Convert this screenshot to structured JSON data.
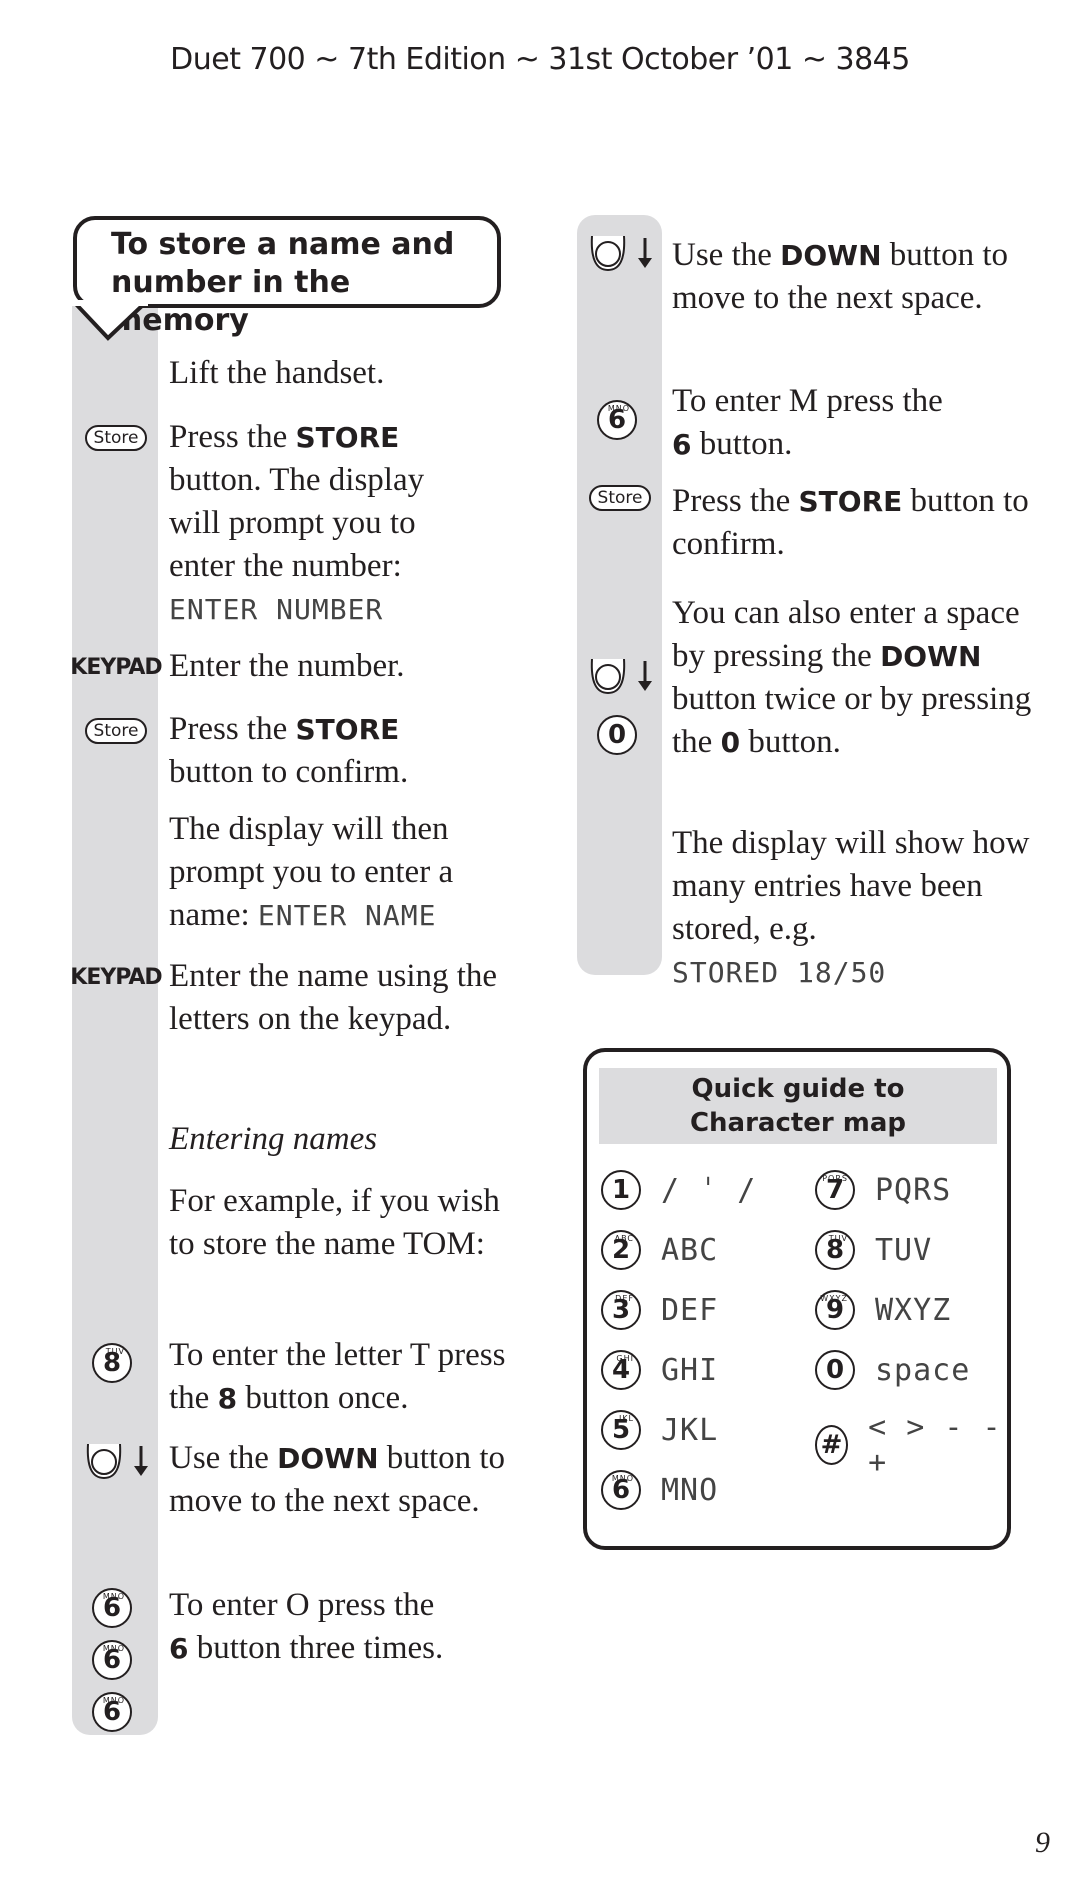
{
  "header": "Duet 700 ~ 7th Edition ~ 31st October ’01 ~ 3845",
  "section_title_line1": "To store a name and",
  "section_title_line2": "number in the memory",
  "left_steps": [
    {
      "icon": "none",
      "text": "Lift the handset."
    },
    {
      "icon": "store-button",
      "icon_label": "Store",
      "pre": "Press the ",
      "bold": "STORE",
      "post": " button. The display will prompt you to enter the number:",
      "lcd": "ENTER NUMBER"
    },
    {
      "icon": "keypad",
      "icon_label": "KEYPAD",
      "text": "Enter the number."
    },
    {
      "icon": "store-button",
      "icon_label": "Store",
      "pre": "Press the ",
      "bold": "STORE",
      "post": " button to confirm."
    },
    {
      "icon": "none",
      "pre": "The display will then prompt you to enter a name: ",
      "lcd": "ENTER NAME"
    },
    {
      "icon": "keypad",
      "icon_label": "KEYPAD",
      "text": "Enter the name using the letters on the keypad."
    },
    {
      "icon": "none",
      "italic": "Entering names"
    },
    {
      "icon": "none",
      "text": "For example, if you wish to store the name TOM:"
    },
    {
      "icon": "key-8",
      "key": "8",
      "key_sub": "TUV",
      "pre": "To enter the letter T press the ",
      "bold": "8",
      "post": " button once."
    },
    {
      "icon": "down-button",
      "pre": "Use the ",
      "bold": "DOWN",
      "post": " button to move to the next space."
    },
    {
      "icon": "key-6-x3",
      "key": "6",
      "key_sub": "MNO",
      "pre": "To enter O press the ",
      "bold": "6",
      "post": " button three times."
    }
  ],
  "right_steps": [
    {
      "icon": "down-button",
      "pre": "Use the ",
      "bold": "DOWN",
      "post": " button to move to the next space."
    },
    {
      "icon": "key-6",
      "key": "6",
      "key_sub": "MNO",
      "pre": "To enter M press the ",
      "bold": "6",
      "post": " button."
    },
    {
      "icon": "store-button",
      "icon_label": "Store",
      "pre": "Press the ",
      "bold": "STORE",
      "post": " button to confirm."
    },
    {
      "icon": "down-and-0",
      "key": "0",
      "pre": "You can also enter a space by pressing the ",
      "bold": "DOWN",
      "post": " button twice or by pressing the ",
      "bold2": "0",
      "post2": " button."
    },
    {
      "icon": "none",
      "pre": "The display will show how many entries have been stored, e.g.",
      "lcd": "STORED 18/50"
    }
  ],
  "guide": {
    "title_line1": "Quick guide to",
    "title_line2": "Character map",
    "left": [
      {
        "key": "1",
        "sub": "",
        "chars": "/ ˈ /"
      },
      {
        "key": "2",
        "sub": "ABC",
        "chars": "ABC"
      },
      {
        "key": "3",
        "sub": "DEF",
        "chars": "DEF"
      },
      {
        "key": "4",
        "sub": "GHI",
        "chars": "GHI"
      },
      {
        "key": "5",
        "sub": "JKL",
        "chars": "JKL"
      },
      {
        "key": "6",
        "sub": "MNO",
        "chars": "MNO"
      }
    ],
    "right": [
      {
        "key": "7",
        "sub": "PQRS",
        "chars": "PQRS"
      },
      {
        "key": "8",
        "sub": "TUV",
        "chars": "TUV"
      },
      {
        "key": "9",
        "sub": "WXYZ",
        "chars": "WXYZ"
      },
      {
        "key": "0",
        "sub": "",
        "chars": "space"
      },
      {
        "key": "#",
        "sub": "",
        "chars": "< > - - +"
      }
    ]
  },
  "page_number": "9"
}
